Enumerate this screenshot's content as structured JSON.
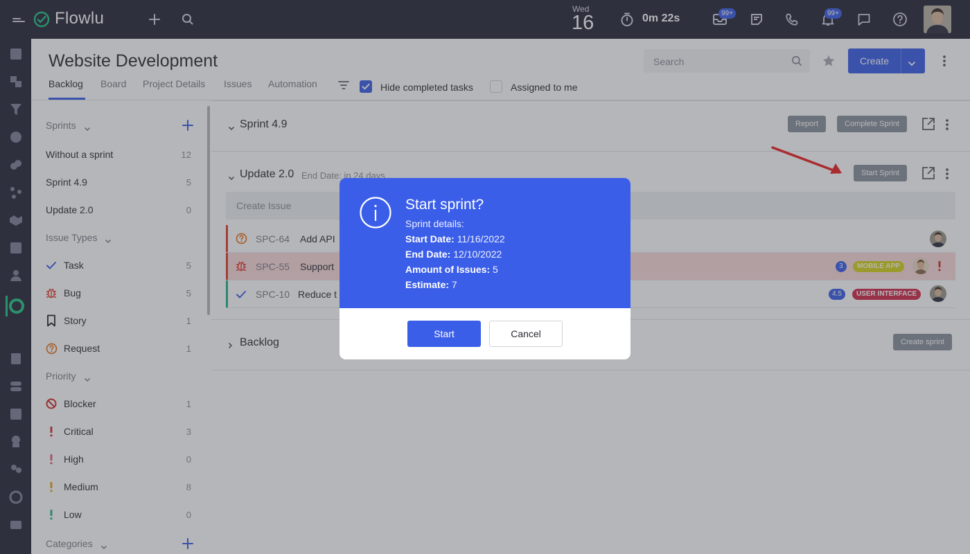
{
  "topbar": {
    "app_name": "Flowlu",
    "date_weekday": "Wed",
    "date_day": "16",
    "timer": "0m 22s",
    "mail_badge": "99+",
    "notif_badge": "99+"
  },
  "header": {
    "title": "Website Development",
    "tabs": [
      "Backlog",
      "Board",
      "Project Details",
      "Issues",
      "Automation"
    ],
    "hide_completed_label": "Hide completed tasks",
    "hide_completed_checked": true,
    "assigned_to_me_label": "Assigned to me",
    "assigned_to_me_checked": false,
    "search_placeholder": "Search",
    "create_label": "Create"
  },
  "sidebar": {
    "sprints_head": "Sprints",
    "sprints": [
      {
        "label": "Without a sprint",
        "count": "12"
      },
      {
        "label": "Sprint 4.9",
        "count": "5"
      },
      {
        "label": "Update 2.0",
        "count": "0"
      }
    ],
    "issue_types_head": "Issue Types",
    "issue_types": [
      {
        "label": "Task",
        "count": "5",
        "icon": "check-icon"
      },
      {
        "label": "Bug",
        "count": "5",
        "icon": "bug-icon"
      },
      {
        "label": "Story",
        "count": "1",
        "icon": "bookmark-icon"
      },
      {
        "label": "Request",
        "count": "1",
        "icon": "question-icon"
      }
    ],
    "priority_head": "Priority",
    "priorities": [
      {
        "label": "Blocker",
        "count": "1",
        "color": "#d12a2a"
      },
      {
        "label": "Critical",
        "count": "3",
        "color": "#d12a2a"
      },
      {
        "label": "High",
        "count": "0",
        "color": "#e25a75"
      },
      {
        "label": "Medium",
        "count": "8",
        "color": "#e8a317"
      },
      {
        "label": "Low",
        "count": "0",
        "color": "#1fb28a"
      }
    ],
    "categories_head": "Categories"
  },
  "sprint49": {
    "title": "Sprint 4.9",
    "report_label": "Report",
    "complete_label": "Complete Sprint"
  },
  "update20": {
    "title": "Update 2.0",
    "end_date": "End Date: in 24 days",
    "start_label": "Start Sprint",
    "create_issue_placeholder": "Create Issue",
    "issues": [
      {
        "key": "SPC-64",
        "name": "Add API",
        "type_icon": "question-icon",
        "bar_color": "#e0402f"
      },
      {
        "key": "SPC-55",
        "name": "Support",
        "type_icon": "bug-icon",
        "bar_color": "#e0402f",
        "estimate": "3",
        "label": "MOBILE APP",
        "label_color": "#d6d21c"
      },
      {
        "key": "SPC-10",
        "name": "Reduce t",
        "type_icon": "check-icon",
        "bar_color": "#1fb28a",
        "estimate": "4.5",
        "label": "USER INTERFACE",
        "label_color": "#d12a4a"
      }
    ]
  },
  "backlog": {
    "title": "Backlog",
    "create_sprint_label": "Create sprint"
  },
  "modal": {
    "title": "Start sprint?",
    "details_label": "Sprint details:",
    "start_date_label": "Start Date:",
    "start_date": "11/16/2022",
    "end_date_label": "End Date:",
    "end_date": "12/10/2022",
    "amount_label": "Amount of Issues:",
    "amount": "5",
    "estimate_label": "Estimate:",
    "estimate": "7",
    "start_button": "Start",
    "cancel_button": "Cancel"
  },
  "colors": {
    "accent": "#3b5ee8",
    "topbar": "#272838"
  }
}
